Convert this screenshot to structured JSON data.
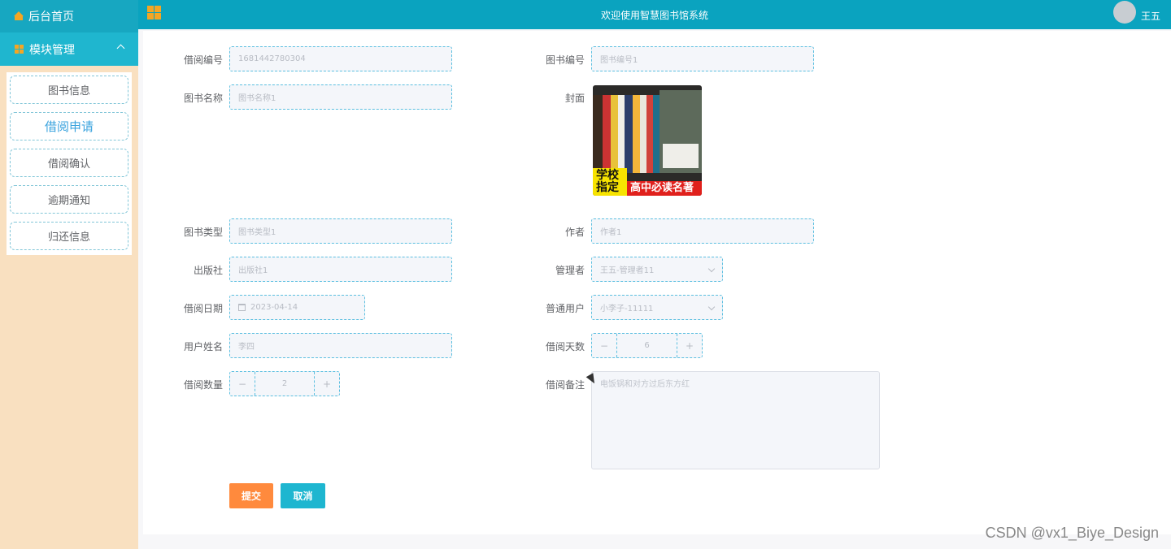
{
  "sidebar": {
    "home_label": "后台首页",
    "module_label": "模块管理",
    "items": [
      {
        "label": "图书信息"
      },
      {
        "label": "借阅申请",
        "active": true
      },
      {
        "label": "借阅确认"
      },
      {
        "label": "逾期通知"
      },
      {
        "label": "归还信息"
      }
    ]
  },
  "header": {
    "title": "欢迎使用智慧图书馆系统",
    "username": "王五"
  },
  "form": {
    "borrow_no": {
      "label": "借阅编号",
      "value": "1681442780304"
    },
    "book_no": {
      "label": "图书编号",
      "placeholder": "图书编号1"
    },
    "book_name": {
      "label": "图书名称",
      "placeholder": "图书名称1"
    },
    "cover": {
      "label": "封面",
      "band_left": "学校指定",
      "band_right": "高中必读名著"
    },
    "book_type": {
      "label": "图书类型",
      "placeholder": "图书类型1"
    },
    "author": {
      "label": "作者",
      "placeholder": "作者1"
    },
    "publisher": {
      "label": "出版社",
      "placeholder": "出版社1"
    },
    "manager": {
      "label": "管理者",
      "value": "王五-管理者11"
    },
    "borrow_date": {
      "label": "借阅日期",
      "value": "2023-04-14"
    },
    "user": {
      "label": "普通用户",
      "value": "小李子-11111"
    },
    "user_name": {
      "label": "用户姓名",
      "value": "李四"
    },
    "borrow_days": {
      "label": "借阅天数",
      "value": "6"
    },
    "borrow_qty": {
      "label": "借阅数量",
      "value": "2"
    },
    "remark": {
      "label": "借阅备注",
      "value": "电饭锅和对方过后东方红"
    },
    "submit_label": "提交",
    "cancel_label": "取消"
  },
  "stepper": {
    "minus": "−",
    "plus": "+"
  },
  "watermark": "CSDN @vx1_Biye_Design",
  "colors": {
    "topbar": "#0aa3bf",
    "sidebar": "#f9e0c0",
    "submit": "#ff8a3d",
    "cancel": "#1eb6d0"
  }
}
